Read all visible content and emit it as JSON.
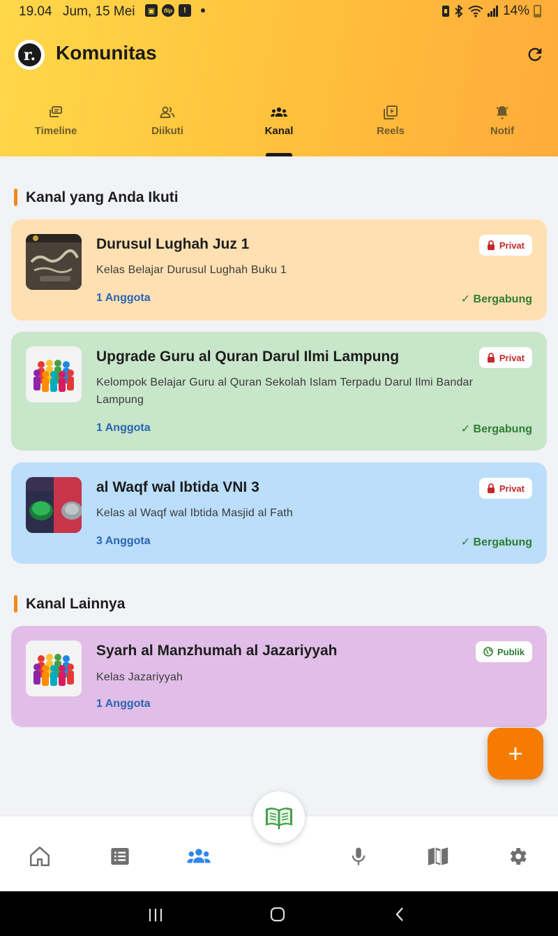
{
  "status_bar": {
    "time": "19.04",
    "date": "Jum, 15 Mei",
    "battery": "14%",
    "flip_icon_label": "flip"
  },
  "header": {
    "logo_letter": "r.",
    "title": "Komunitas",
    "refresh_icon": "refresh-icon"
  },
  "tabs": [
    {
      "label": "Timeline",
      "icon": "timeline-icon",
      "active": false
    },
    {
      "label": "Diikuti",
      "icon": "people-icon",
      "active": false
    },
    {
      "label": "Kanal",
      "icon": "groups-icon",
      "active": true
    },
    {
      "label": "Reels",
      "icon": "video-library-icon",
      "active": false
    },
    {
      "label": "Notif",
      "icon": "bell-icon",
      "active": false
    }
  ],
  "sections": {
    "followed_title": "Kanal yang Anda Ikuti",
    "others_title": "Kanal Lainnya"
  },
  "followed_channels": [
    {
      "title": "Durusul Lughah Juz 1",
      "description": "Kelas Belajar Durusul Lughah Buku 1",
      "members": "1 Anggota",
      "badge": "Privat",
      "joined": "✓ Bergabung",
      "bg_color": "#ffe0b2",
      "thumbnail": "book-cover-thumbnail"
    },
    {
      "title": "Upgrade Guru al Quran Darul Ilmi Lampung",
      "description": "Kelompok Belajar Guru al Quran Sekolah Islam Terpadu Darul Ilmi Bandar Lampung",
      "members": "1 Anggota",
      "badge": "Privat",
      "joined": "✓ Bergabung",
      "bg_color": "#c8e6c9",
      "thumbnail": "people-group-thumbnail"
    },
    {
      "title": "al Waqf wal Ibtida VNI 3",
      "description": "Kelas al Waqf wal Ibtida Masjid al Fath",
      "members": "3 Anggota",
      "badge": "Privat",
      "joined": "✓ Bergabung",
      "bg_color": "#bbdefb",
      "thumbnail": "buttons-thumbnail"
    }
  ],
  "other_channels": [
    {
      "title": "Syarh al Manzhumah al Jazariyyah",
      "description": "Kelas Jazariyyah",
      "members": "1 Anggota",
      "badge": "Publik",
      "bg_color": "#e1bee7",
      "thumbnail": "people-group-thumbnail"
    }
  ],
  "fab": {
    "icon": "plus-icon"
  },
  "bottom_nav": [
    {
      "icon": "home-icon",
      "active": false
    },
    {
      "icon": "list-icon",
      "active": false
    },
    {
      "icon": "community-icon",
      "active": true
    },
    {
      "icon": "quran-book-icon",
      "active": false
    },
    {
      "icon": "mic-icon",
      "active": false
    },
    {
      "icon": "map-book-icon",
      "active": false
    },
    {
      "icon": "settings-icon",
      "active": false
    }
  ],
  "colors": {
    "accent_orange": "#f57c00",
    "member_blue": "#2a64b4",
    "joined_green": "#2e7d32",
    "private_red": "#c62828",
    "public_green": "#2e7d32",
    "nav_active": "#2f86eb",
    "nav_inactive": "#707070"
  }
}
